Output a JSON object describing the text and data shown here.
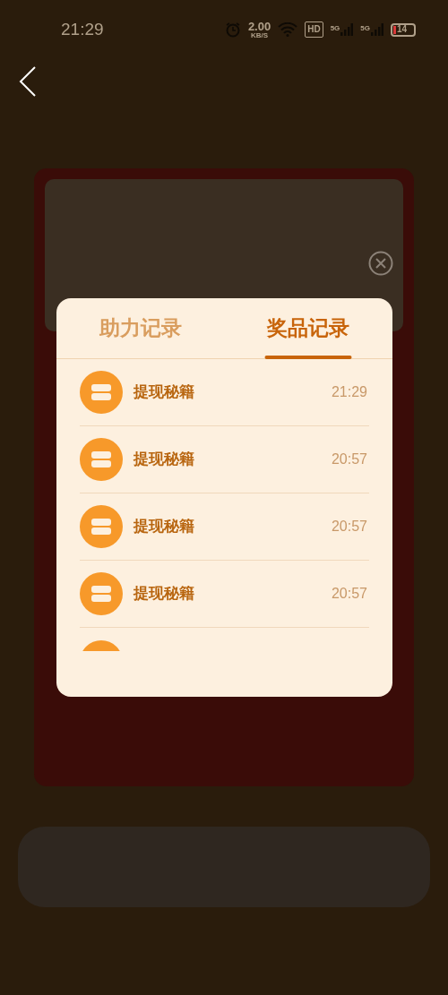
{
  "status_bar": {
    "time": "21:29",
    "net_speed": "2.00",
    "net_unit": "KB/S",
    "hd": "HD",
    "signals": [
      "5G",
      "5G"
    ],
    "battery": "14"
  },
  "dialog": {
    "tabs": [
      {
        "label": "助力记录",
        "selected": false
      },
      {
        "label": "奖品记录",
        "selected": true
      }
    ],
    "records": [
      {
        "name": "提现秘籍",
        "time": "21:29"
      },
      {
        "name": "提现秘籍",
        "time": "20:57"
      },
      {
        "name": "提现秘籍",
        "time": "20:57"
      },
      {
        "name": "提现秘籍",
        "time": "20:57"
      }
    ]
  }
}
